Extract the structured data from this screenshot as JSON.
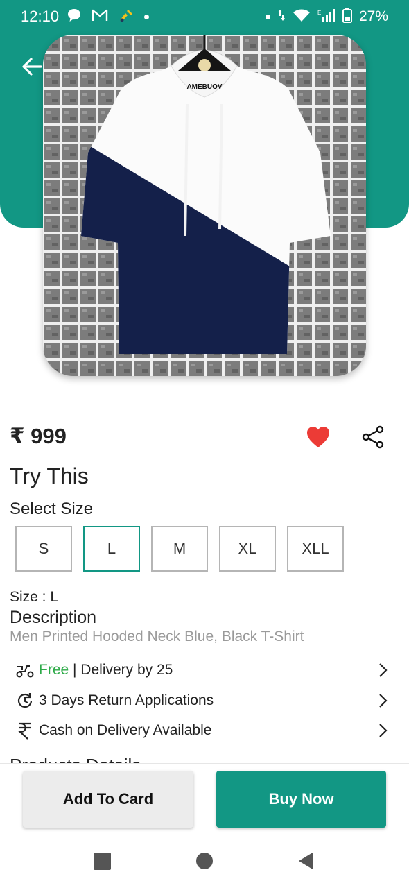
{
  "status_bar": {
    "time": "12:10",
    "battery": "27%",
    "icons": [
      "chat-icon",
      "gmail-icon",
      "notification-icon",
      "dot-icon",
      "wifi-icon",
      "signal-icon",
      "battery-icon"
    ]
  },
  "header": {
    "back_icon": "arrow-left-icon",
    "background": "#129784"
  },
  "product": {
    "image_brand_tag": "AMEBUOV",
    "price": "₹ 999",
    "title": "Try This",
    "select_size_label": "Select Size",
    "sizes": [
      "S",
      "L",
      "M",
      "XL",
      "XLL"
    ],
    "selected_size_index": 1,
    "selected_size_text": "Size : L",
    "description_heading": "Description",
    "description_text": "Men Printed Hooded Neck Blue, Black T-Shirt",
    "favorite_icon": "heart-icon",
    "favorite_color": "#ec3b36",
    "share_icon": "share-icon"
  },
  "info": {
    "delivery_free": "Free",
    "delivery_rest": " | Delivery by 25",
    "returns": "3 Days Return Applications",
    "cod": "Cash on Delivery Available"
  },
  "next_section_heading": "Products Details",
  "actions": {
    "add_to_card": "Add To Card",
    "buy_now": "Buy Now",
    "accent": "#129784"
  },
  "nav": {
    "recents_icon": "square-icon",
    "home_icon": "circle-icon",
    "back_icon": "triangle-back-icon"
  }
}
